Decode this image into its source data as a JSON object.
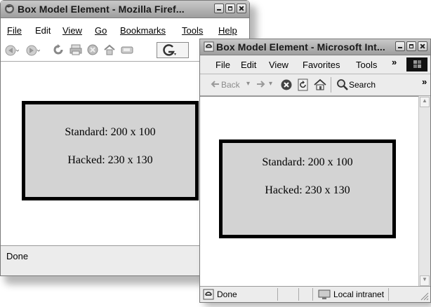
{
  "firefox": {
    "title": "Box Model Element - Mozilla Firef...",
    "menus": [
      "File",
      "Edit",
      "View",
      "Go",
      "Bookmarks",
      "Tools",
      "Help"
    ],
    "box": {
      "standard": "Standard: 200 x 100",
      "hacked": "Hacked: 230 x 130"
    },
    "status": "Done"
  },
  "ie": {
    "title": "Box Model Element - Microsoft Int...",
    "menus": [
      "File",
      "Edit",
      "View",
      "Favorites",
      "Tools"
    ],
    "menu_overflow": "»",
    "toolbar": {
      "back": "Back",
      "search": "Search",
      "overflow": "»"
    },
    "box": {
      "standard": "Standard: 200 x 100",
      "hacked": "Hacked: 230 x 130"
    },
    "status": "Done",
    "zone": "Local intranet"
  }
}
